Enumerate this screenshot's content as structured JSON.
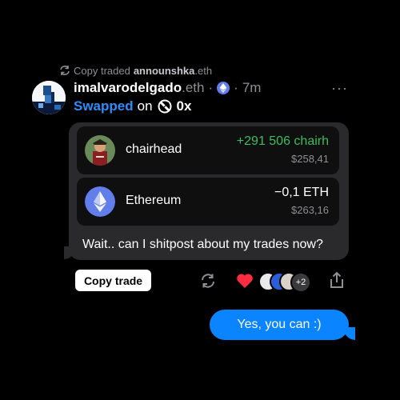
{
  "repost": {
    "prefix": "Copy traded",
    "user": "announshka",
    "tld": ".eth"
  },
  "post": {
    "user": "imalvarodelgado",
    "tld": ".eth",
    "separator": "·",
    "time": "7m",
    "action": "Swapped",
    "on": "on",
    "dex": "0x",
    "more": "···"
  },
  "trade": {
    "rows": [
      {
        "token": "chairhead",
        "amount": "+291 506 chairh",
        "usd": "$258,41",
        "amount_color": "#3dbd5d"
      },
      {
        "token": "Ethereum",
        "amount": "−0,1 ETH",
        "usd": "$263,16",
        "amount_color": "#ffffff"
      }
    ],
    "message": "Wait.. can I shitpost about my trades now?"
  },
  "actions": {
    "copy_label": "Copy trade",
    "reaction_extra": "+2"
  },
  "reply": {
    "text": "Yes, you can :)"
  },
  "colors": {
    "accent": "#2e8dfa",
    "positive": "#3dbd5d",
    "heart": "#ff2d3f",
    "bubble": "#0a84ff"
  },
  "icons": [
    "repost-icon",
    "eth-badge-icon",
    "0x-logo-icon",
    "more-icon",
    "ethereum-icon",
    "repost-action-icon",
    "heart-icon",
    "share-icon"
  ]
}
